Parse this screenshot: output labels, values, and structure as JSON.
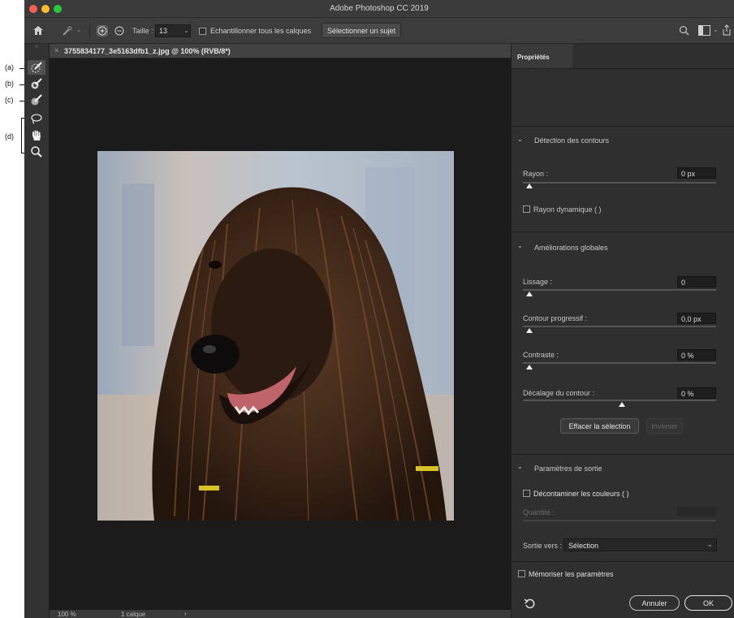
{
  "window": {
    "title": "Adobe Photoshop CC 2019"
  },
  "annotations": [
    "(a)",
    "(b)",
    "(c)",
    "(d)"
  ],
  "options_bar": {
    "size_label": "Taille :",
    "size_value": "13",
    "sample_all_label": "Echantillonner tous les calques",
    "select_subject_label": "Sélectionner un sujet"
  },
  "document": {
    "tab_title": "3755834177_3e5163dfb1_z.jpg @ 100% (RVB/8*)",
    "zoom": "100 %",
    "layers": "1 calque"
  },
  "properties": {
    "tab_label": "Propriétés",
    "edge_detection": {
      "title": "Détection des contours",
      "radius_label": "Rayon :",
      "radius_value": "0 px",
      "smart_radius_label": "Rayon dynamique (  )"
    },
    "global_refinements": {
      "title": "Améliorations globales",
      "smooth_label": "Lissage :",
      "smooth_value": "0",
      "feather_label": "Contour progressif :",
      "feather_value": "0,0 px",
      "contrast_label": "Contraste :",
      "contrast_value": "0 %",
      "shift_edge_label": "Décalage du contour :",
      "shift_edge_value": "0 %",
      "clear_selection_label": "Effacer la sélection",
      "invert_label": "Inverser"
    },
    "output_settings": {
      "title": "Paramètres de sortie",
      "decontaminate_label": "Décontaminer les couleurs (  )",
      "amount_label": "Quantité :",
      "output_to_label": "Sortie vers :",
      "output_to_value": "Sélection"
    },
    "remember_label": "Mémoriser les paramètres",
    "cancel_label": "Annuler",
    "ok_label": "OK"
  },
  "sliders": {
    "radius": 0,
    "smooth": 0,
    "feather": 0,
    "contrast": 0,
    "shift_edge": 0
  },
  "colors": {
    "panel": "#2f2f2f",
    "canvas": "#1b1b1b",
    "toolbar": "#3c3c3c"
  }
}
